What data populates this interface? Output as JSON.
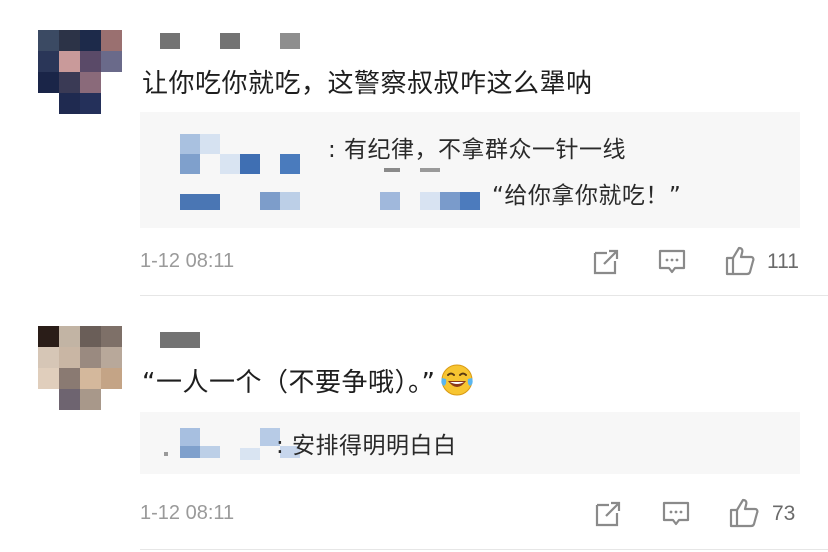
{
  "comments": [
    {
      "text": "让你吃你就吃，这警察叔叔咋这么犟呐",
      "reply_lines": [
        ": 有纪律，不拿群众一针一线",
        "“给你拿你就吃！”"
      ],
      "time": "1-12 08:11",
      "likes": "111"
    },
    {
      "text": "“一人一个（不要争哦）。”",
      "emoji": "laughing-tears-emoji",
      "reply_lines": [
        ": 安排得明明白白"
      ],
      "time": "1-12 08:11",
      "likes": "73"
    }
  ],
  "icons": [
    "share-icon",
    "comment-icon",
    "like-icon"
  ],
  "colors": {
    "reply_bg": "#f7f7f7",
    "icon_gray": "#8a8a8a",
    "mosaic_blue": "#4a78b8",
    "time_gray": "#9a9a9a"
  }
}
